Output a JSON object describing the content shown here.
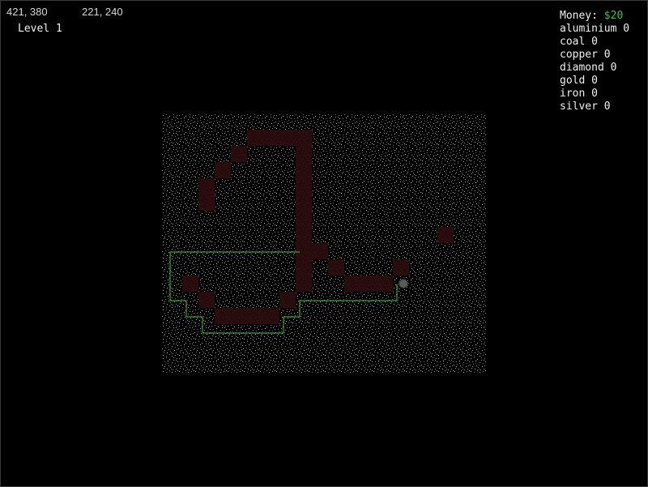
{
  "header": {
    "cursor_coords": "421, 380",
    "origin_coords": "221, 240",
    "level_label": "Level 1"
  },
  "hud": {
    "money_label": "Money:",
    "money_value": "$20",
    "resources": [
      {
        "name": "aluminium",
        "count": 0
      },
      {
        "name": "coal",
        "count": 0
      },
      {
        "name": "copper",
        "count": 0
      },
      {
        "name": "diamond",
        "count": 0
      },
      {
        "name": "gold",
        "count": 0
      },
      {
        "name": "iron",
        "count": 0
      },
      {
        "name": "silver",
        "count": 0
      }
    ]
  },
  "colors": {
    "background": "#000000",
    "ground_speckle": "#8a8a8a",
    "tunnel": "#2a0c0e",
    "path": "#2fd02f",
    "drill_head": "#5a5a5a",
    "money": "#3ec43e"
  },
  "icons": {
    "drill": "drill-head-icon"
  }
}
